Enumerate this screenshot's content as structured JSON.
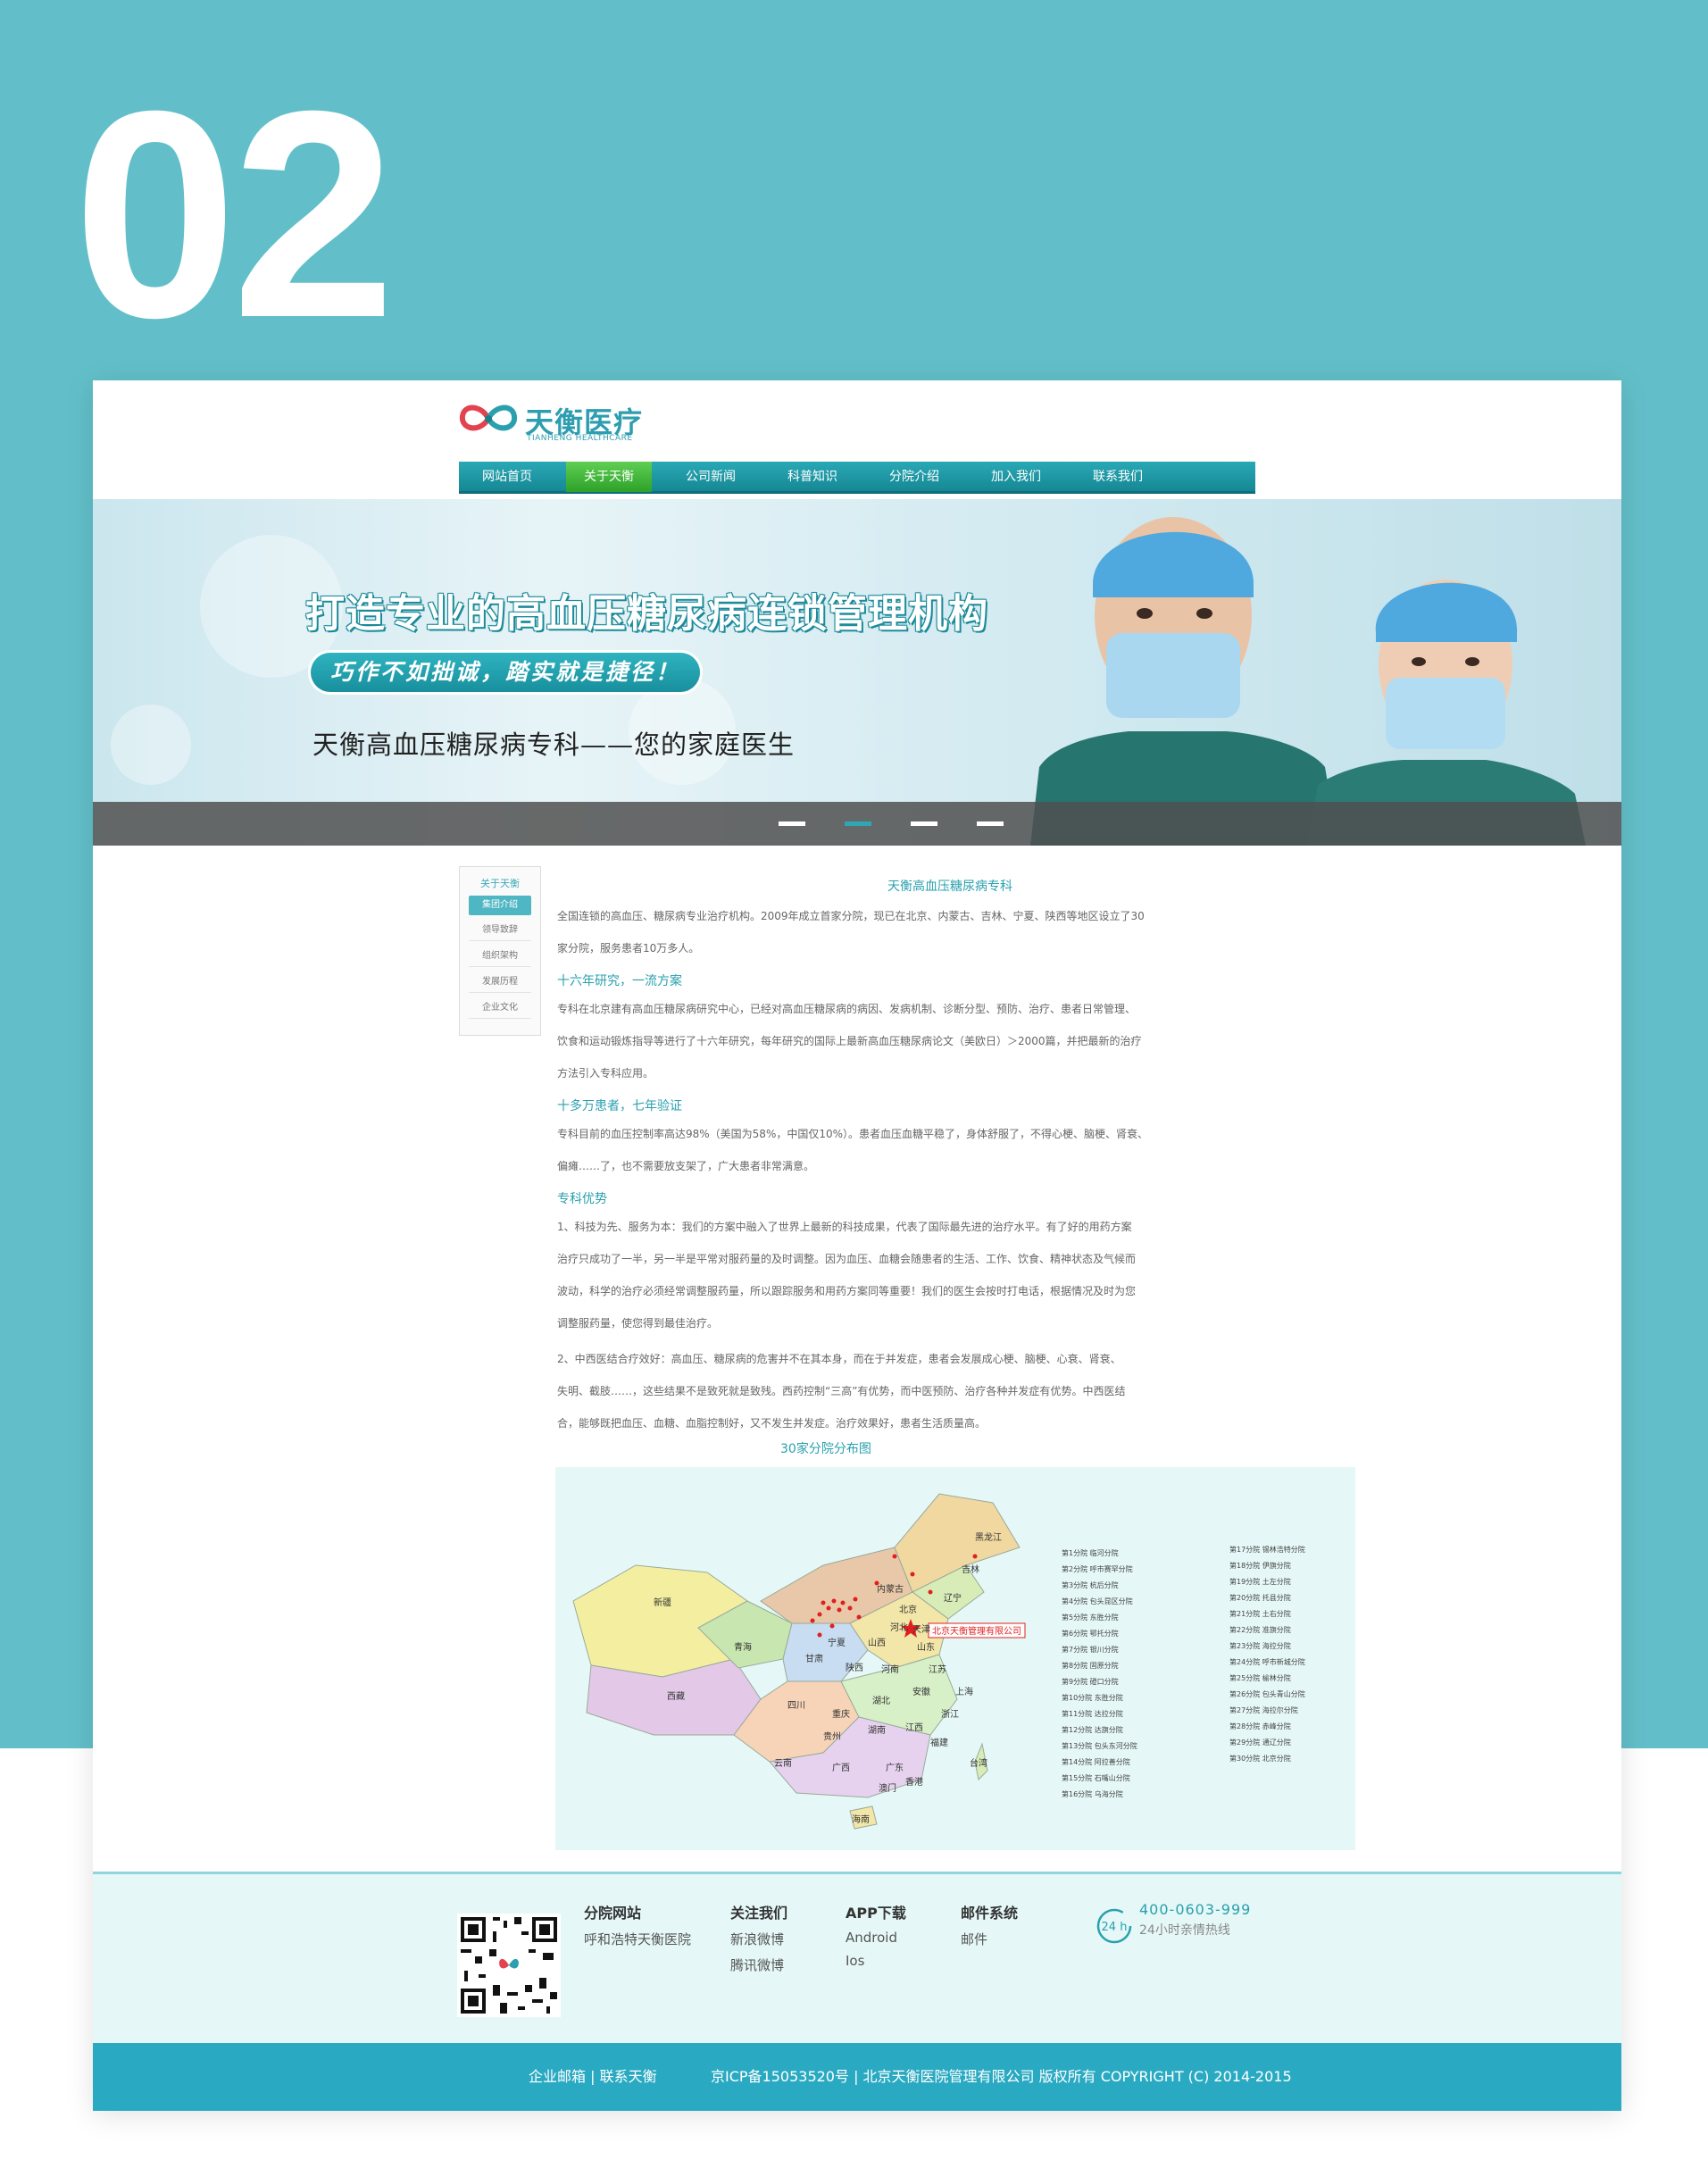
{
  "slide_number": "02",
  "logo": {
    "cn": "天衡医疗",
    "en": "TIANHENG HEALTHCARE"
  },
  "nav": [
    "网站首页",
    "关于天衡",
    "公司新闻",
    "科普知识",
    "分院介绍",
    "加入我们",
    "联系我们"
  ],
  "banner": {
    "headline": "打造专业的高血压糖尿病连锁管理机构",
    "slogan": "巧作不如拙诚，踏实就是捷径！",
    "subtitle": "天衡高血压糖尿病专科——您的家庭医生",
    "active_dot": 2
  },
  "side_menu": {
    "title": "关于天衡",
    "items": [
      "集团介绍",
      "领导致辞",
      "组织架构",
      "发展历程",
      "企业文化"
    ]
  },
  "content": {
    "title": "天衡高血压糖尿病专科",
    "intro": [
      "全国连锁的高血压、糖尿病专业治疗机构。2009年成立首家分院，现已在北京、内蒙古、吉林、宁夏、陕西等地区设立了30",
      "家分院，服务患者10万多人。"
    ],
    "s1_heading": "十六年研究，一流方案",
    "s1_lines": [
      "专科在北京建有高血压糖尿病研究中心，已经对高血压糖尿病的病因、发病机制、诊断分型、预防、治疗、患者日常管理、",
      "饮食和运动锻炼指导等进行了十六年研究，每年研究的国际上最新高血压糖尿病论文（美欧日）＞2000篇，并把最新的治疗",
      "方法引入专科应用。"
    ],
    "s2_heading": "十多万患者，七年验证",
    "s2_lines": [
      "专科目前的血压控制率高达98%（美国为58%，中国仅10%）。患者血压血糖平稳了，身体舒服了，不得心梗、脑梗、肾衰、",
      "偏瘫……了，也不需要放支架了，广大患者非常满意。"
    ],
    "s3_heading": "专科优势",
    "s3_p1": [
      "1、科技为先、服务为本：我们的方案中融入了世界上最新的科技成果，代表了国际最先进的治疗水平。有了好的用药方案",
      "治疗只成功了一半，另一半是平常对服药量的及时调整。因为血压、血糖会随患者的生活、工作、饮食、精神状态及气候而",
      "波动，科学的治疗必须经常调整服药量，所以跟踪服务和用药方案同等重要！我们的医生会按时打电话，根据情况及时为您",
      "调整服药量，使您得到最佳治疗。"
    ],
    "s3_p2": [
      "2、中西医结合疗效好：高血压、糖尿病的危害并不在其本身，而在于并发症，患者会发展成心梗、脑梗、心衰、肾衰、",
      "失明、截肢……，这些结果不是致死就是致残。西药控制“三高”有优势，而中医预防、治疗各种并发症有优势。中西医结",
      "合，能够既把血压、血糖、血脂控制好，又不发生并发症。治疗效果好，患者生活质量高。"
    ]
  },
  "map": {
    "title": "30家分院分布图",
    "hq_label": "北京天衡管理有限公司",
    "provinces": [
      "黑龙江",
      "吉林",
      "辽宁",
      "内蒙古",
      "新疆",
      "北京",
      "天津",
      "河北",
      "山西",
      "山东",
      "宁夏",
      "青海",
      "甘肃",
      "陕西",
      "河南",
      "江苏",
      "西藏",
      "四川",
      "重庆",
      "湖北",
      "安徽",
      "上海",
      "浙江",
      "贵州",
      "湖南",
      "江西",
      "福建",
      "云南",
      "广西",
      "广东",
      "台湾",
      "香港",
      "澳门",
      "海南"
    ],
    "branches_left": [
      "第1分院  临河分院",
      "第2分院  呼市赛罕分院",
      "第3分院  杭后分院",
      "第4分院  包头昆区分院",
      "第5分院  东胜分院",
      "第6分院  鄂托分院",
      "第7分院  银川分院",
      "第8分院  固原分院",
      "第9分院  磴口分院",
      "第10分院  东胜分院",
      "第11分院  达拉分院",
      "第12分院  达旗分院",
      "第13分院  包头东河分院",
      "第14分院  阿拉善分院",
      "第15分院  石嘴山分院",
      "第16分院  乌海分院"
    ],
    "branches_right": [
      "第17分院  锡林浩特分院",
      "第18分院  伊旗分院",
      "第19分院  土左分院",
      "第20分院  托县分院",
      "第21分院  土右分院",
      "第22分院  准旗分院",
      "第23分院  海拉分院",
      "第24分院  呼市新城分院",
      "第25分院  榆林分院",
      "第26分院  包头青山分院",
      "第27分院  海拉尔分院",
      "第28分院  赤峰分院",
      "第29分院  通辽分院",
      "第30分院  北京分院"
    ]
  },
  "footer": {
    "branch_site": {
      "head": "分院网站",
      "items": [
        "呼和浩特天衡医院"
      ]
    },
    "follow": {
      "head": "关注我们",
      "items": [
        "新浪微博",
        "腾讯微博"
      ]
    },
    "app": {
      "head": "APP下载",
      "items": [
        "Android",
        "Ios"
      ]
    },
    "mail": {
      "head": "邮件系统",
      "items": [
        "邮件"
      ]
    },
    "hotline": {
      "number": "400-0603-999",
      "text": "24小时亲情热线",
      "icon_text": "24 h"
    }
  },
  "bottom_bar": {
    "links": "企业邮箱 | 联系天衡",
    "copyright": "京ICP备15053520号 | 北京天衡医院管理有限公司 版权所有 COPYRIGHT (C) 2014-2015"
  },
  "colors": {
    "teal_bg": "#62bfc9",
    "accent": "#2aa0ae",
    "nav_active": "#3fb63a",
    "footer_bar": "#2aaac2"
  }
}
